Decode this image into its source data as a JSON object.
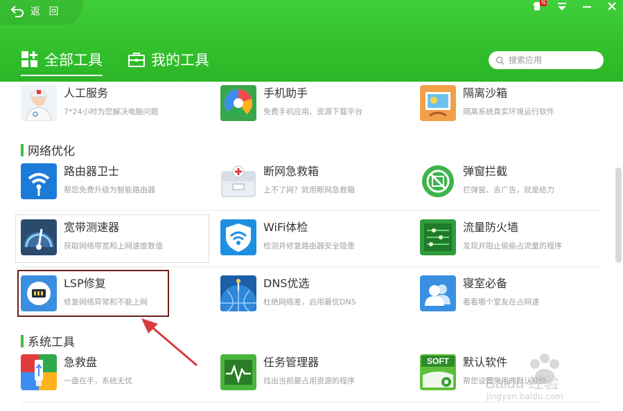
{
  "header": {
    "back_label": "返 回",
    "badge": "N",
    "tabs": [
      {
        "label": "全部工具",
        "active": true
      },
      {
        "label": "我的工具",
        "active": false
      }
    ],
    "search_placeholder": "搜索应用"
  },
  "top_row": [
    {
      "name": "人工服务",
      "desc": "7*24小时为您解决电脑问题",
      "icon": "doctor-icon"
    },
    {
      "name": "手机助手",
      "desc": "免费手机应用、资源下载平台",
      "icon": "phone-assistant-icon"
    },
    {
      "name": "隔离沙箱",
      "desc": "隔离系统真实环境运行软件",
      "icon": "sandbox-icon"
    }
  ],
  "network": {
    "title": "网络优化",
    "items": [
      {
        "name": "路由器卫士",
        "desc": "帮您免费升级为智能路由器",
        "icon": "router-icon"
      },
      {
        "name": "断网急救箱",
        "desc": "上不了网？就用断网急救箱",
        "icon": "first-aid-kit-icon"
      },
      {
        "name": "弹窗拦截",
        "desc": "拦弹窗、去广告，就是给力",
        "icon": "popup-block-icon"
      },
      {
        "name": "宽带测速器",
        "desc": "获取网络带宽和上网速度数值",
        "icon": "speedometer-icon"
      },
      {
        "name": "WiFi体检",
        "desc": "检测并修复路由器安全隐患",
        "icon": "wifi-shield-icon"
      },
      {
        "name": "流量防火墙",
        "desc": "发现并阻止偷偷占流量的程序",
        "icon": "traffic-firewall-icon"
      },
      {
        "name": "LSP修复",
        "desc": "修复网络异常和不能上网",
        "icon": "lsp-chip-icon"
      },
      {
        "name": "DNS优选",
        "desc": "杜绝网络差，启用最优DNS",
        "icon": "dns-globe-icon"
      },
      {
        "name": "寝室必备",
        "desc": "看看哪个室友在占网速",
        "icon": "roommates-icon"
      }
    ]
  },
  "system": {
    "title": "系统工具",
    "items": [
      {
        "name": "急救盘",
        "desc": "一盘在手，系统无忧",
        "icon": "rescue-usb-icon"
      },
      {
        "name": "任务管理器",
        "desc": "找出当前最占用资源的程序",
        "icon": "task-manager-icon"
      },
      {
        "name": "默认软件",
        "desc": "帮您设置常用的默认软件",
        "icon": "soft-default-icon"
      }
    ],
    "soft_badge": "SOFT"
  },
  "watermark": {
    "text": "Baidu 经验",
    "sub": "jingyan.baidu.com"
  },
  "colors": {
    "header_green": "#33c12d",
    "accent": "#3cc13a",
    "annotation": "#6b1d1d",
    "arrow": "#d93a3a"
  }
}
